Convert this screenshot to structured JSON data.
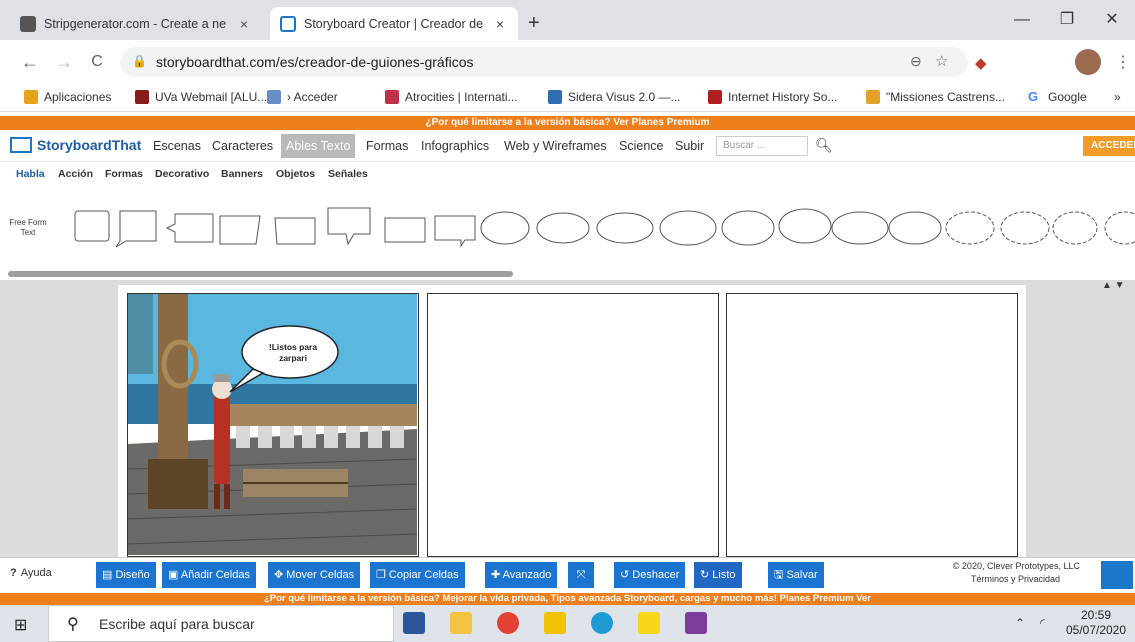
{
  "browser": {
    "tabs": [
      {
        "title": "Stripgenerator.com - Create a ne",
        "close": "×"
      },
      {
        "title": "Storyboard Creator | Creador de",
        "close": "×"
      }
    ],
    "new_tab": "+",
    "window_controls": {
      "minimize": "—",
      "maximize": "❐",
      "close": "✕"
    },
    "url": "storyboardthat.com/es/creador-de-guiones-gráficos",
    "nav": {
      "back": "←",
      "forward": "→",
      "reload": "C"
    },
    "bookmarks": [
      {
        "label": "Aplicaciones",
        "color": "#e8a21a"
      },
      {
        "label": "UVa Webmail [ALU...",
        "color": "#8b1a1a"
      },
      {
        "label": "› Acceder",
        "color": "#6a8fc7"
      },
      {
        "label": "Atrocities | Internati...",
        "color": "#c0304a"
      },
      {
        "label": "Sidera Visus 2.0 —...",
        "color": "#2f6fb1"
      },
      {
        "label": "Internet History So...",
        "color": "#b01f1f"
      },
      {
        "label": "\"Missiones Castrens...",
        "color": "#e2a22a"
      },
      {
        "label": "Google",
        "color": "#4285f4"
      }
    ],
    "more_bookmarks": "»"
  },
  "site": {
    "promo_top": "¿Por qué limitarse a la versión básica? Ver Planes Premium",
    "logo": "StoryboardThat",
    "nav": [
      "Escenas",
      "Caracteres",
      "Ables Texto",
      "Formas",
      "Infographics",
      "Web y Wireframes",
      "Science",
      "Subir"
    ],
    "search_placeholder": "Buscar ...",
    "login": "ACCEDER",
    "subnav": [
      "Habla",
      "Acción",
      "Formas",
      "Decorativo",
      "Banners",
      "Objetos",
      "Señales"
    ],
    "shelf_label": "Free Form Text",
    "speech_text": "!Listos para zarpari",
    "updown": "▲ ▼",
    "toolbar": {
      "help": "Ayuda",
      "design": "Diseño",
      "add_cells": "Añadir Celdas",
      "move_cells": "Mover Celdas",
      "copy_cells": "Copiar Celdas",
      "advanced": "Avanzado",
      "undo": "Deshacer",
      "done": "Listo",
      "save": "Salvar"
    },
    "copyright": "© 2020, Clever Prototypes, LLC",
    "terms": "Términos y Privacidad",
    "promo_bottom": "¿Por qué limitarse a la versión básica? Mejorar la vida privada, Tipos avanzada Storyboard, cargas y mucho más! Planes Premium Ver"
  },
  "taskbar": {
    "search_placeholder": "Escribe aquí para buscar",
    "time": "20:59",
    "date": "05/07/2020"
  }
}
